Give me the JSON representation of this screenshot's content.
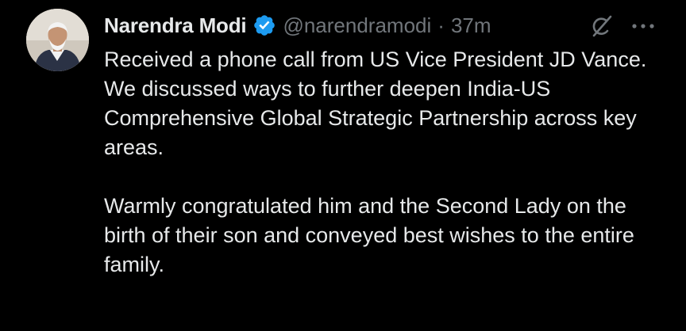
{
  "tweet": {
    "author": {
      "name": "Narendra Modi",
      "handle": "@narendramodi",
      "verified": true
    },
    "separator": "·",
    "time": "37m",
    "paragraphs": [
      "Received a phone call from US Vice President JD Vance. We discussed ways to further deepen India-US Comprehensive Global Strategic Partnership across key areas.",
      "Warmly congratulated him and the Second Lady on the birth of their son and conveyed best wishes to the entire family."
    ]
  },
  "icons": {
    "verified": "verified-badge-icon",
    "grok": "grok-icon",
    "more": "more-options-icon"
  },
  "colors": {
    "background": "#000000",
    "text_primary": "#e7e9ea",
    "text_secondary": "#71767b",
    "verified_badge": "#1d9bf0"
  }
}
